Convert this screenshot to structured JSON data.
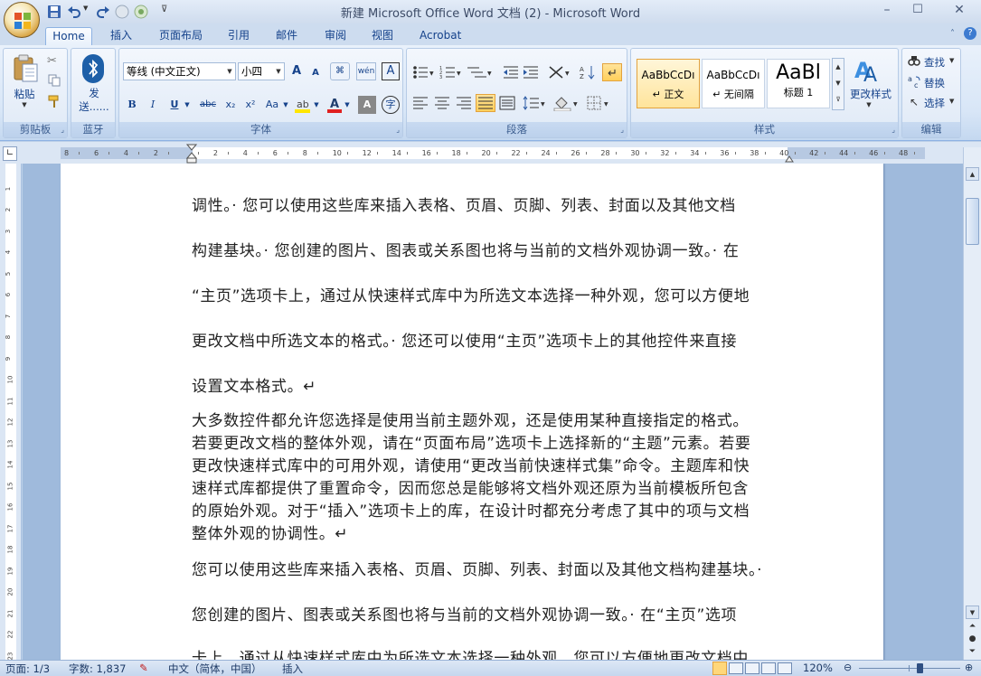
{
  "window": {
    "title": "新建 Microsoft Office Word 文档 (2) - Microsoft Word",
    "controls": [
      "–",
      "☐",
      "✕"
    ]
  },
  "tabs": [
    {
      "label": "Home",
      "active": true
    },
    {
      "label": "插入"
    },
    {
      "label": "页面布局"
    },
    {
      "label": "引用"
    },
    {
      "label": "邮件"
    },
    {
      "label": "审阅"
    },
    {
      "label": "视图"
    },
    {
      "label": "Acrobat"
    }
  ],
  "ribbon": {
    "clipboard": {
      "paste_label": "粘贴",
      "group_label": "剪贴板"
    },
    "bluetooth": {
      "send_label": "发送......",
      "group_label": "蓝牙"
    },
    "font": {
      "font_name": "等线 (中文正文)",
      "font_size": "小四",
      "group_label": "字体",
      "bold": "B",
      "italic": "I",
      "underline": "U",
      "strike": "abc",
      "subscript": "x₂",
      "superscript": "x²",
      "change_case": "Aa",
      "grow": "A",
      "shrink": "A",
      "pinyin": "wén",
      "border_char": "A",
      "char_shading": "A"
    },
    "paragraph": {
      "group_label": "段落"
    },
    "styles": {
      "group_label": "样式",
      "items": [
        {
          "preview": "AaBbCcDı",
          "name": "↵ 正文",
          "selected": true
        },
        {
          "preview": "AaBbCcDı",
          "name": "↵ 无间隔"
        },
        {
          "preview": "AaBl",
          "name": "标题 1"
        }
      ],
      "change_styles": "更改样式"
    },
    "editing": {
      "group_label": "编辑",
      "find": "查找",
      "replace": "替换",
      "select": "选择"
    }
  },
  "ruler_numbers": [
    "8",
    "6",
    "4",
    "2",
    "",
    "2",
    "4",
    "6",
    "8",
    "10",
    "12",
    "14",
    "16",
    "18",
    "20",
    "22",
    "24",
    "26",
    "28",
    "30",
    "32",
    "34",
    "36",
    "38",
    "40",
    "42",
    "44",
    "46",
    "48"
  ],
  "document": {
    "lines": [
      {
        "text": "调性。· 您可以使用这些库来插入表格、页眉、页脚、列表、封面以及其他文档"
      },
      {
        "text": "构建基块。· 您创建的图片、图表或关系图也将与当前的文档外观协调一致。· 在"
      },
      {
        "text": "“主页”选项卡上，通过从快速样式库中为所选文本选择一种外观，您可以方便地"
      },
      {
        "text": "更改文档中所选文本的格式。· 您还可以使用“主页”选项卡上的其他控件来直接"
      },
      {
        "text": "设置文本格式。↵"
      },
      {
        "text": "大多数控件都允许您选择是使用当前主题外观，还是使用某种直接指定的格式。"
      },
      {
        "text": "若要更改文档的整体外观，请在“页面布局”选项卡上选择新的“主题”元素。若要"
      },
      {
        "text": "更改快速样式库中的可用外观，请使用“更改当前快速样式集”命令。主题库和快"
      },
      {
        "text": "速样式库都提供了重置命令，因而您总是能够将文档外观还原为当前模板所包含"
      },
      {
        "text": "的原始外观。对于“插入”选项卡上的库，在设计时都充分考虑了其中的项与文档"
      },
      {
        "text": "整体外观的协调性。↵"
      },
      {
        "text": "您可以使用这些库来插入表格、页眉、页脚、列表、封面以及其他文档构建基块。·"
      },
      {
        "text": "您创建的图片、图表或关系图也将与当前的文档外观协调一致。· 在“主页”选项"
      },
      {
        "text": "卡上，通过从快速样式库中为所选文本选择一种外观，您可以方便地更改文档中"
      }
    ]
  },
  "status": {
    "page": "页面: 1/3",
    "words": "字数: 1,837",
    "language": "中文（简体，中国）",
    "mode": "插入",
    "zoom": "120%",
    "zoom_level": 0.6
  },
  "colors": {
    "highlight": "#ffe600",
    "font_color": "#e02020"
  }
}
